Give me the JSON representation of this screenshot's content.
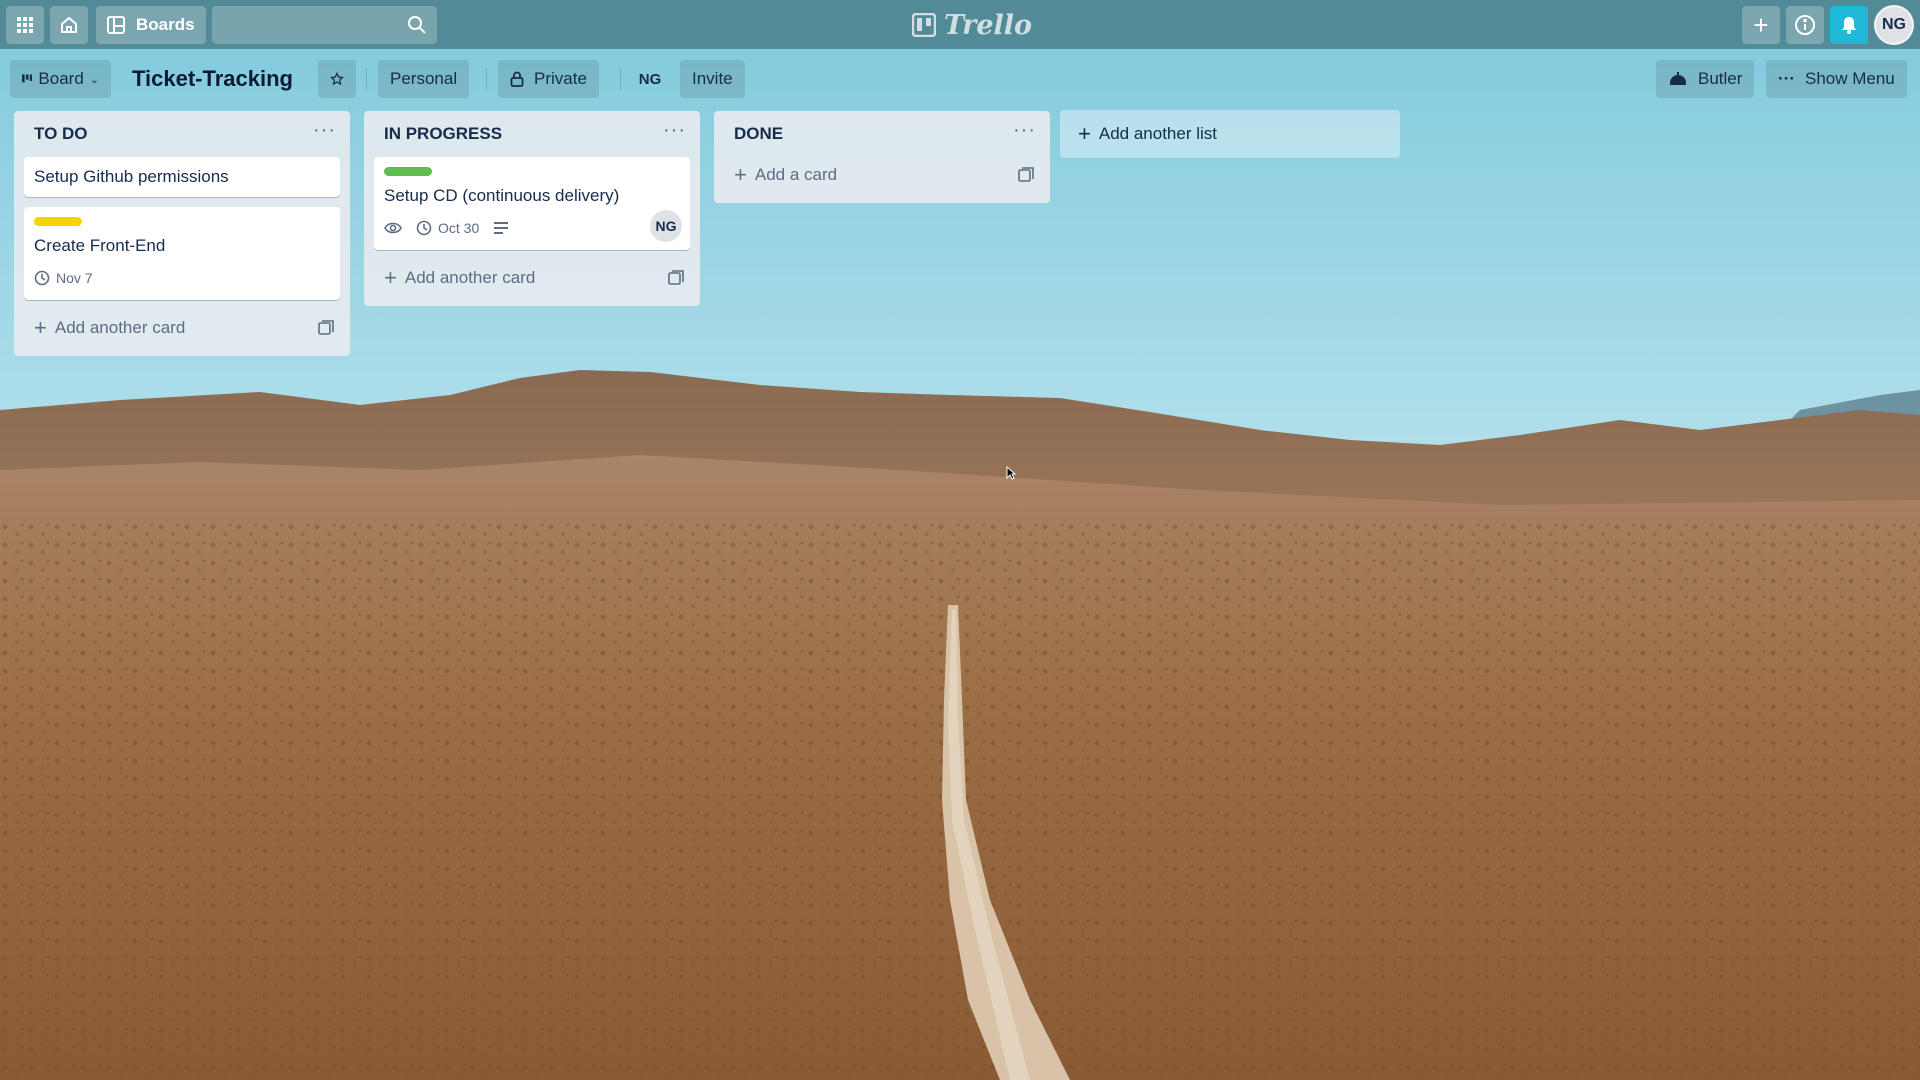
{
  "topbar": {
    "boards_label": "Boards",
    "logo_text": "Trello",
    "avatar_initials": "NG",
    "icons": [
      "apps-grid-icon",
      "home-icon",
      "board-icon",
      "search-icon",
      "plus-icon",
      "info-icon",
      "bell-icon"
    ]
  },
  "board_header": {
    "view_label": "Board",
    "title": "Ticket-Tracking",
    "team_label": "Personal",
    "visibility_label": "Private",
    "member_initials": "NG",
    "invite_label": "Invite",
    "butler_label": "Butler",
    "menu_label": "Show Menu"
  },
  "lists": [
    {
      "title": "TO DO",
      "cards": [
        {
          "title": "Setup Github permissions"
        },
        {
          "title": "Create Front-End",
          "label_color": "#f2d600",
          "due": "Nov 7"
        }
      ],
      "add_label": "Add another card"
    },
    {
      "title": "IN PROGRESS",
      "cards": [
        {
          "title": "Setup CD (continuous delivery)",
          "label_color": "#61bd4f",
          "due": "Oct 30",
          "member": "NG"
        }
      ],
      "add_label": "Add another card"
    },
    {
      "title": "DONE",
      "cards": [],
      "add_label": "Add a card"
    }
  ],
  "add_list_label": "Add another list",
  "colors": {
    "topbar": "#4a808c",
    "notification": "#1fb8d6",
    "sky": "#bfe4ef",
    "desert": "#a8764a"
  }
}
